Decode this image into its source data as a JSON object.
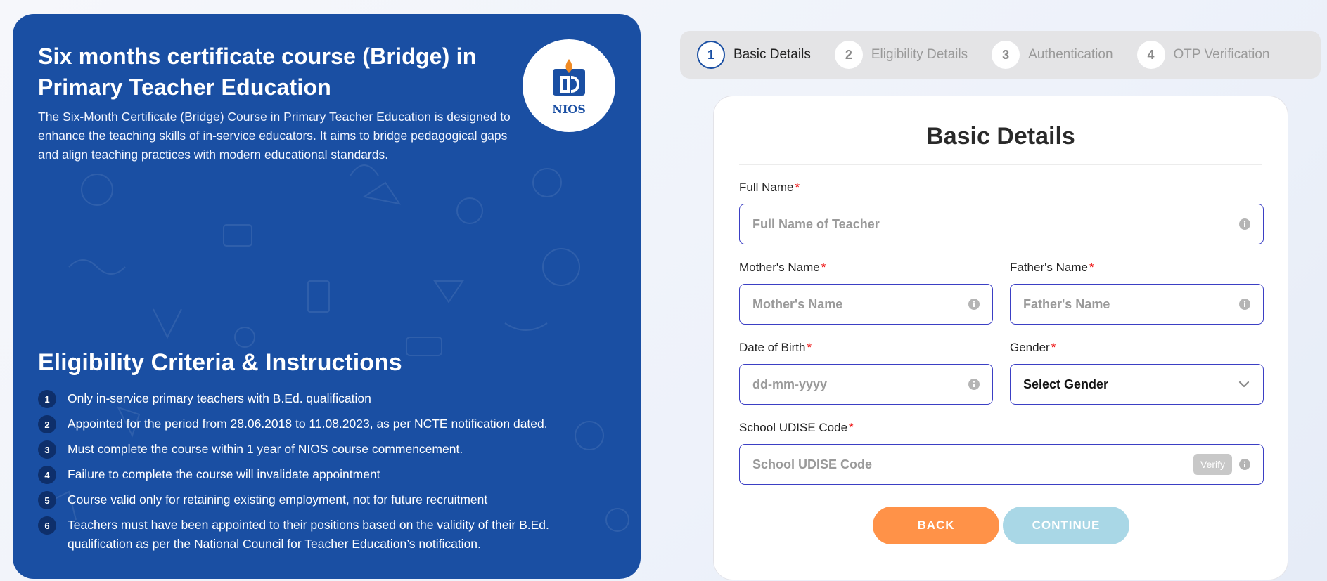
{
  "course": {
    "title": "Six months certificate course (Bridge) in Primary Teacher Education",
    "description": "The Six-Month Certificate (Bridge) Course in Primary Teacher Education is designed to enhance the teaching skills of in-service educators. It aims to bridge pedagogical gaps and align teaching practices with modern educational standards.",
    "logo_text": "NIOS",
    "panel_color": "#1a4fa3"
  },
  "eligibility": {
    "title": "Eligibility Criteria & Instructions",
    "items": [
      {
        "num": "1",
        "text": "Only in-service primary teachers with B.Ed. qualification"
      },
      {
        "num": "2",
        "text": "Appointed for the period from 28.06.2018 to 11.08.2023, as per NCTE notification dated."
      },
      {
        "num": "3",
        "text": "Must complete the course within 1 year of NIOS course commencement."
      },
      {
        "num": "4",
        "text": "Failure to complete the course will invalidate appointment"
      },
      {
        "num": "5",
        "text": "Course valid only for retaining existing employment, not for future recruitment"
      },
      {
        "num": "6",
        "text": "Teachers must have been appointed to their positions based on the validity of their B.Ed. qualification as per the National Council for Teacher Education’s notification."
      }
    ]
  },
  "stepper": {
    "steps": [
      {
        "num": "1",
        "label": "Basic Details",
        "active": true
      },
      {
        "num": "2",
        "label": "Eligibility Details",
        "active": false
      },
      {
        "num": "3",
        "label": "Authentication",
        "active": false
      },
      {
        "num": "4",
        "label": "OTP Verification",
        "active": false
      }
    ]
  },
  "form": {
    "title": "Basic Details",
    "full_name": {
      "label": "Full Name",
      "placeholder": "Full Name of Teacher",
      "value": ""
    },
    "mother_name": {
      "label": "Mother's Name",
      "placeholder": "Mother's Name",
      "value": ""
    },
    "father_name": {
      "label": "Father's Name",
      "placeholder": "Father's Name",
      "value": ""
    },
    "dob": {
      "label": "Date of Birth",
      "placeholder": "dd-mm-yyyy",
      "value": ""
    },
    "gender": {
      "label": "Gender",
      "value": "Select Gender"
    },
    "udise": {
      "label": "School UDISE Code",
      "placeholder": "School UDISE Code",
      "value": "",
      "verify_label": "Verify"
    },
    "required_mark": "*",
    "back_label": "BACK",
    "continue_label": "CONTINUE",
    "accent_color": "#3b3fc4",
    "back_color": "#ff9248",
    "continue_color": "#a9d7e6"
  }
}
